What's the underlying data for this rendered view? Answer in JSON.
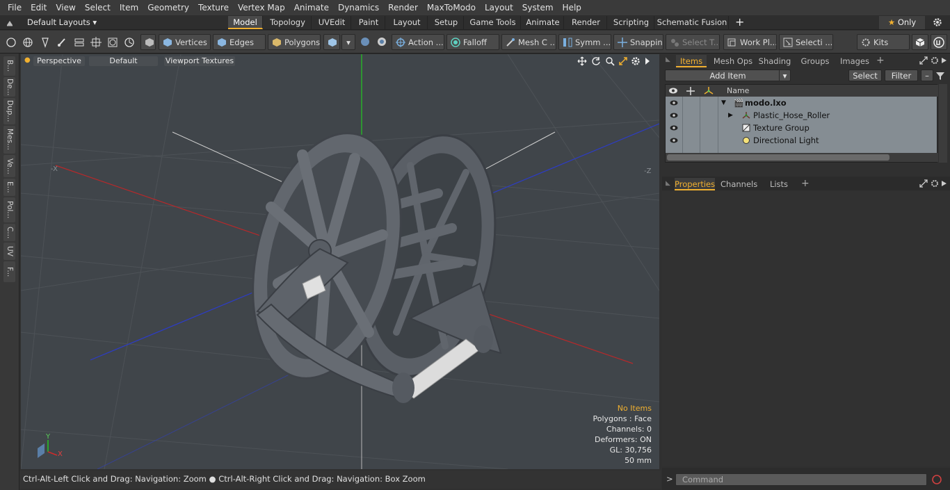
{
  "menu": [
    "File",
    "Edit",
    "View",
    "Select",
    "Item",
    "Geometry",
    "Texture",
    "Vertex Map",
    "Animate",
    "Dynamics",
    "Render",
    "MaxToModo",
    "Layout",
    "System",
    "Help"
  ],
  "layout_selector": "Default Layouts",
  "layout_tabs": [
    "Model",
    "Topology",
    "UVEdit",
    "Paint",
    "Layout",
    "Setup",
    "Game Tools",
    "Animate",
    "Render",
    "Scripting",
    "Schematic Fusion"
  ],
  "layout_tab_active": "Model",
  "layout_add": "+",
  "only_label": "Only",
  "toolbar": {
    "vertices": "Vertices",
    "edges": "Edges",
    "polygons": "Polygons",
    "action": "Action ...",
    "falloff": "Falloff",
    "mesh_c": "Mesh C ...",
    "symm": "Symm ...",
    "snapping": "Snapping",
    "select_t": "Select T...",
    "work_pl": "Work Pl...",
    "selecti": "Selecti ...",
    "kits": "Kits"
  },
  "left_tabs": [
    "B...",
    "De...",
    "Dup...",
    "Mes...",
    "Ve...",
    "E...",
    "Pol...",
    "C...",
    "UV",
    "F..."
  ],
  "viewport": {
    "view_mode": "Perspective",
    "shading": "Default",
    "textures": "Viewport Textures",
    "axis_neg_x": "-X",
    "axis_neg_z": "-Z",
    "axis_y": "Y",
    "axis_x": "X"
  },
  "hud": {
    "selection": "No Items",
    "polygons": "Polygons : Face",
    "channels": "Channels: 0",
    "deformers": "Deformers: ON",
    "gl": "GL: 30,756",
    "scale": "50 mm"
  },
  "status_text_1": "Ctrl-Alt-Left Click and Drag: Navigation: Zoom",
  "status_text_2": "Ctrl-Alt-Right Click and Drag: Navigation: Box Zoom",
  "items_panel": {
    "tabs": [
      "Items",
      "Mesh Ops",
      "Shading",
      "Groups",
      "Images"
    ],
    "active_tab": "Items",
    "add_item": "Add Item",
    "select": "Select",
    "filter": "Filter",
    "column_name": "Name",
    "rows": [
      {
        "name": "modo.lxo",
        "type": "scene"
      },
      {
        "name": "Plastic_Hose_Roller",
        "type": "mesh"
      },
      {
        "name": "Texture Group",
        "type": "texture"
      },
      {
        "name": "Directional Light",
        "type": "light"
      }
    ]
  },
  "properties_panel": {
    "tabs": [
      "Properties",
      "Channels",
      "Lists"
    ],
    "active_tab": "Properties"
  },
  "command_placeholder": "Command",
  "colors": {
    "accent": "#f0b030",
    "viewport_bg": "#40454a",
    "axis_x": "#c0282a",
    "axis_y": "#1ec81e",
    "axis_z": "#2438c8",
    "item_list_bg": "#858d93"
  }
}
